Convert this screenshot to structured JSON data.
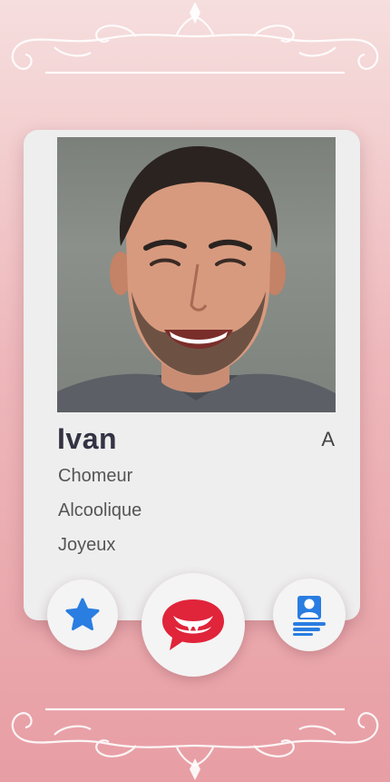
{
  "profile": {
    "name": "Ivan",
    "grade": "A",
    "traits": [
      "Chomeur",
      "Alcoolique",
      "Joyeux"
    ]
  },
  "actions": {
    "favorite_icon": "star-icon",
    "bite_icon": "vampire-mouth-chat-icon",
    "profile_icon": "profile-card-icon"
  },
  "colors": {
    "accent_blue": "#2a7de1",
    "accent_red": "#e0243a",
    "card_bg": "#eeeeee"
  }
}
